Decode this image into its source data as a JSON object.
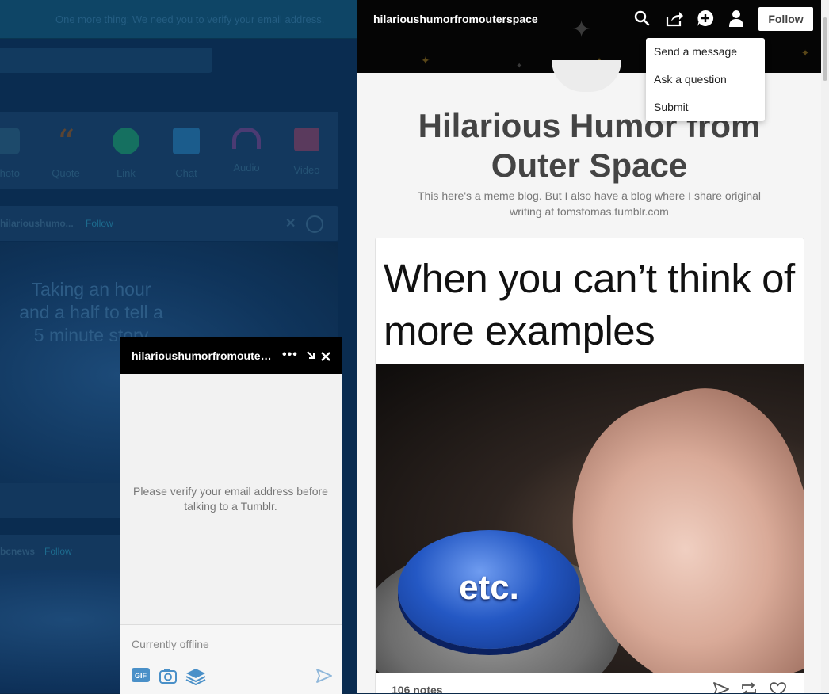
{
  "dashboard": {
    "banner": "One more thing: We need you to verify your email address.",
    "post_types": [
      {
        "label": "Photo",
        "icon": "camera-icon",
        "color": "#1d5a7e"
      },
      {
        "label": "Quote",
        "icon": "quote-icon",
        "color": "#6b4a33"
      },
      {
        "label": "Link",
        "icon": "link-icon",
        "color": "#15705a"
      },
      {
        "label": "Chat",
        "icon": "chat-icon",
        "color": "#1b5c8c"
      },
      {
        "label": "Audio",
        "icon": "headphones-icon",
        "color": "#4b3b73"
      },
      {
        "label": "Video",
        "icon": "video-icon",
        "color": "#5a3a5d"
      }
    ],
    "post1_blog": "hilarioushumo...",
    "post1_follow": "Follow",
    "post1_text": "Taking an hour and a half to tell a 5 minute story",
    "post2_blog": "bcnews",
    "post2_follow": "Follow"
  },
  "chat": {
    "title": "hilarioushumorfromouterspace",
    "more": "•••",
    "notice": "Please verify your email address before talking to a Tumblr.",
    "status": "Currently offline",
    "tools": {
      "gif": "GIF"
    }
  },
  "blog": {
    "name": "hilarioushumorfromouterspace",
    "follow_label": "Follow",
    "title": "Hilarious Humor from Outer Space",
    "description": "This here's a meme blog. But I also have a blog where I share original writing at tomsfomas.tumblr.com",
    "post": {
      "caption": "When you can’t think of more examples",
      "button_text": "etc.",
      "notes": "106 notes"
    }
  },
  "menu": {
    "items": [
      "Send a message",
      "Ask a question",
      "Submit"
    ]
  }
}
